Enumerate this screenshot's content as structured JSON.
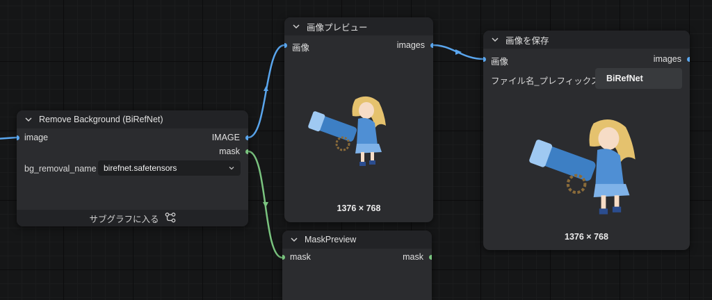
{
  "colors": {
    "image_wire": "#5aa6ee",
    "mask_wire": "#7ac47f",
    "node_bg": "#2b2c2f",
    "header_bg": "#222326"
  },
  "remove_bg_node": {
    "title": "Remove Background (BiRefNet)",
    "input_image": "image",
    "output_image": "IMAGE",
    "output_mask": "mask",
    "widget_label": "bg_removal_name",
    "widget_value": "birefnet.safetensors",
    "footer_label": "サブグラフに入る",
    "footer_icon": "subgraph-icon"
  },
  "preview_node": {
    "title": "画像プレビュー",
    "input_image": "画像",
    "output_images": "images",
    "dimensions": "1376 × 768"
  },
  "save_node": {
    "title": "画像を保存",
    "input_image": "画像",
    "output_images": "images",
    "prefix_label": "ファイル名_プレフィックス",
    "prefix_value": "BiRefNet",
    "dimensions": "1376 × 768"
  },
  "mask_node": {
    "title": "MaskPreview",
    "input_mask": "mask",
    "output_mask": "mask"
  }
}
